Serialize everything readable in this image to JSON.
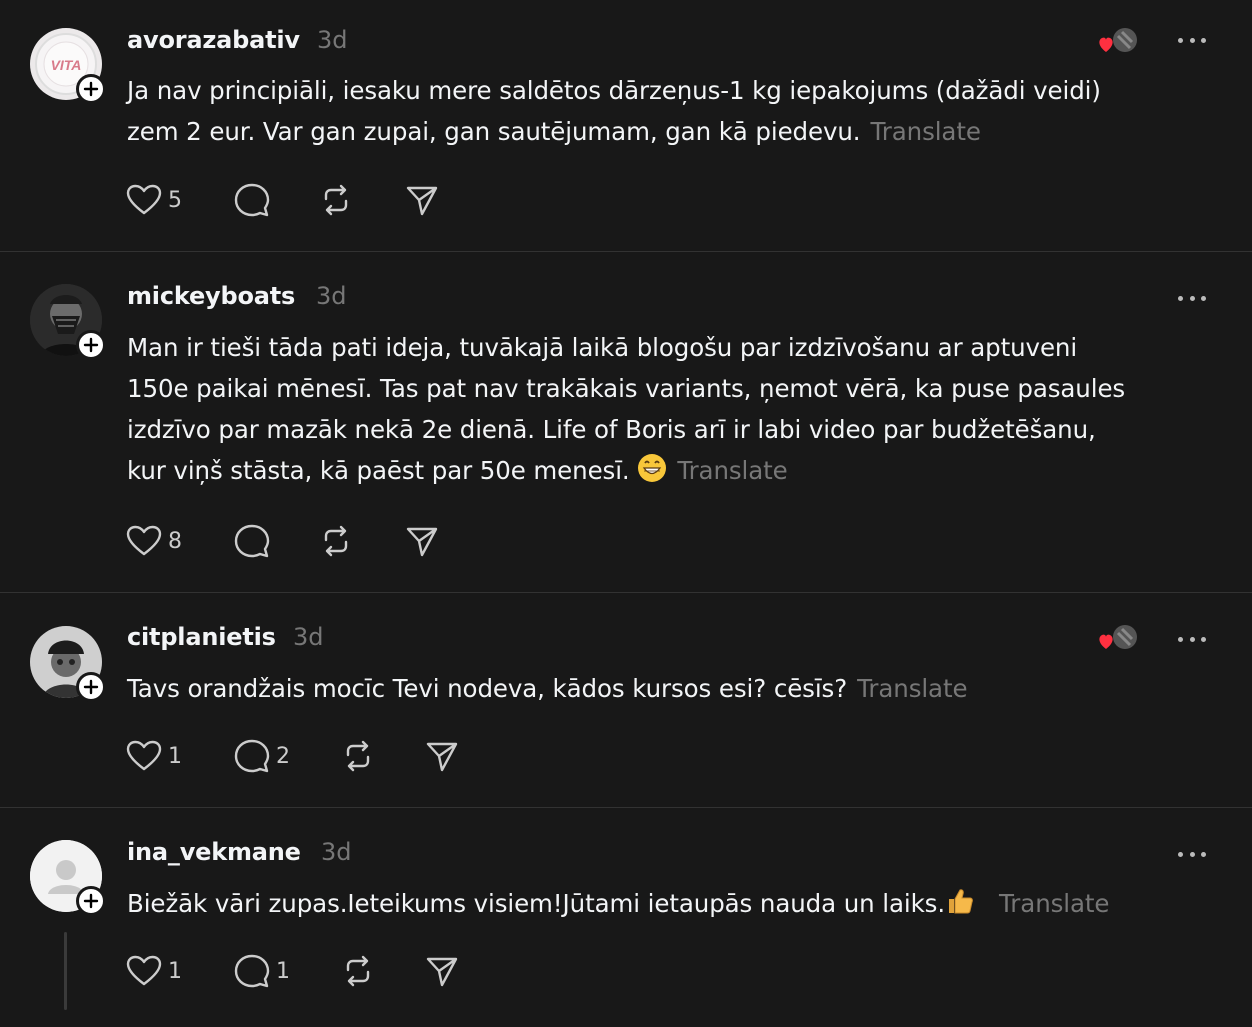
{
  "posts": [
    {
      "username": "avorazabativ",
      "time": "3d",
      "text_lines": [
        "Ja nav principiāli, iesaku mere saldētos dārzeņus-1 kg iepakojums (dažādi veidi)",
        "zem 2 eur. Var gan zupai, gan sautējumam, gan kā piedevu."
      ],
      "translate": "Translate",
      "likes": "5",
      "replies": "",
      "avatar_icon": "vita-logo-avatar",
      "liked_by_author": true
    },
    {
      "username": "mickeyboats",
      "time": "3d",
      "text_lines": [
        "Man ir tieši tāda pati ideja, tuvākajā laikā blogošu par izdzīvošanu ar aptuveni",
        "150e paikai mēnesī. Tas pat nav trakākais variants, ņemot vērā, ka puse pasaules",
        "izdzīvo par mazāk nekā 2e dienā. Life of Boris arī ir labi video par budžetēšanu,",
        "kur viņš stāsta, kā paēst par 50e menesī."
      ],
      "emoji": "grinning-face-emoji",
      "translate": "Translate",
      "likes": "8",
      "replies": "",
      "avatar_icon": "masked-person-avatar",
      "liked_by_author": false
    },
    {
      "username": "citplanietis",
      "time": "3d",
      "text_lines": [
        "Tavs orandžais mocīc Tevi nodeva, kādos kursos esi? cēsīs?"
      ],
      "translate": "Translate",
      "likes": "1",
      "replies": "2",
      "avatar_icon": "person-with-hat-avatar",
      "liked_by_author": true
    },
    {
      "username": "ina_vekmane",
      "time": "3d",
      "text_lines": [
        "Biežāk vāri zupas.Ieteikums visiem!Jūtami ietaupās nauda un laiks."
      ],
      "emoji": "thumbs-up-emoji",
      "translate": "Translate",
      "likes": "1",
      "replies": "1",
      "avatar_icon": "default-user-avatar",
      "liked_by_author": false
    }
  ],
  "colors": {
    "background": "#181818",
    "text": "#f3f5f7",
    "muted": "#777777",
    "divider": "#323232",
    "heart": "#ff3040"
  }
}
